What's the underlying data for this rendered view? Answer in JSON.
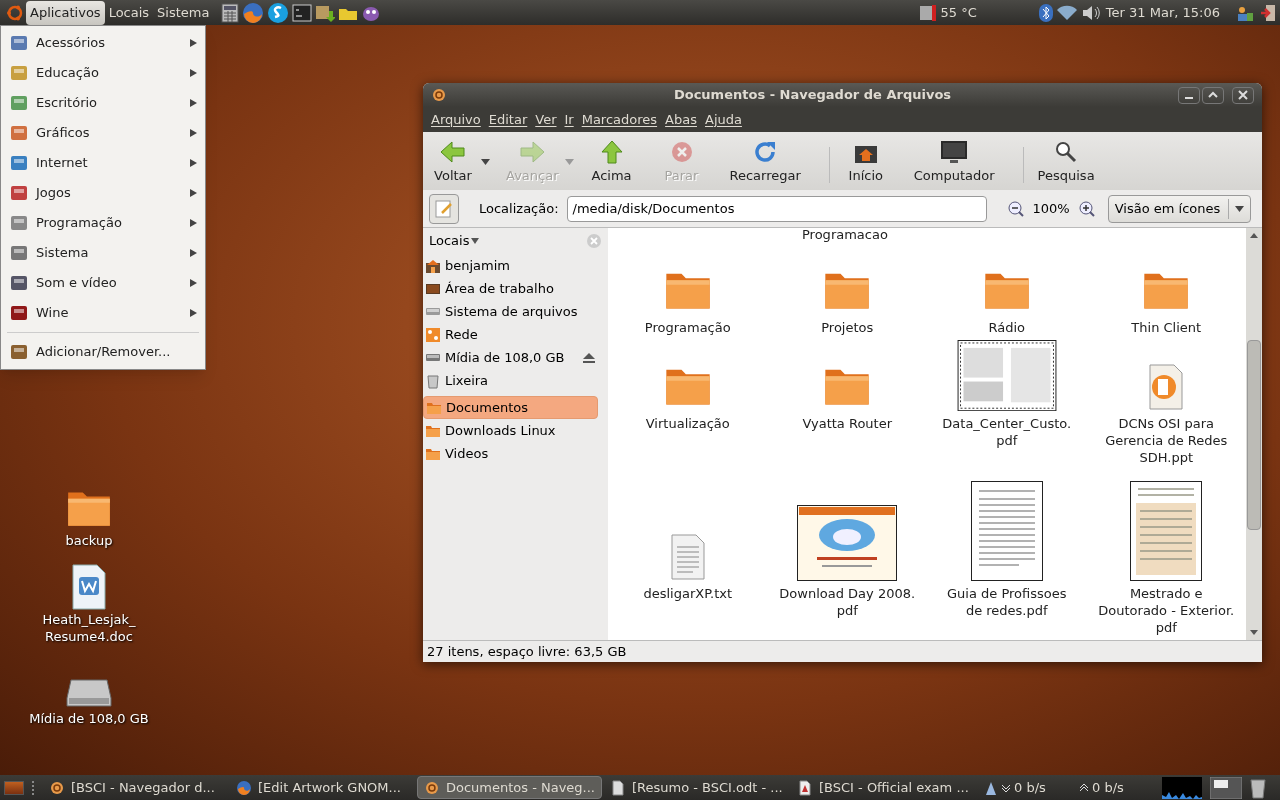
{
  "top_panel": {
    "menus": [
      {
        "label": "Aplicativos",
        "selected": true
      },
      {
        "label": "Locais",
        "selected": false
      },
      {
        "label": "Sistema",
        "selected": false
      }
    ],
    "temperature": "55 °C",
    "clock": "Ter 31 Mar, 15:06"
  },
  "app_menu": {
    "items": [
      {
        "label": "Acessórios",
        "kind": "submenu"
      },
      {
        "label": "Educação",
        "kind": "submenu"
      },
      {
        "label": "Escritório",
        "kind": "submenu"
      },
      {
        "label": "Gráficos",
        "kind": "submenu"
      },
      {
        "label": "Internet",
        "kind": "submenu"
      },
      {
        "label": "Jogos",
        "kind": "submenu"
      },
      {
        "label": "Programação",
        "kind": "submenu"
      },
      {
        "label": "Sistema",
        "kind": "submenu"
      },
      {
        "label": "Som e vídeo",
        "kind": "submenu"
      },
      {
        "label": "Wine",
        "kind": "submenu"
      },
      {
        "label": "Adicionar/Remover...",
        "kind": "action"
      }
    ]
  },
  "desktop_icons": [
    {
      "label": "backup",
      "kind": "folder"
    },
    {
      "label": "Heath_Lesjak_\nResume4.doc",
      "kind": "document"
    },
    {
      "label": "Mídia de 108,0 GB",
      "kind": "drive"
    }
  ],
  "window": {
    "title": "Documentos - Navegador de Arquivos",
    "menu": [
      "Arquivo",
      "Editar",
      "Ver",
      "Ir",
      "Marcadores",
      "Abas",
      "Ajuda"
    ],
    "toolbar": [
      {
        "label": "Voltar",
        "kind": "back",
        "disabled": false,
        "dropdown": true
      },
      {
        "label": "Avançar",
        "kind": "forward",
        "disabled": true,
        "dropdown": true
      },
      {
        "label": "Acima",
        "kind": "up",
        "disabled": false,
        "dropdown": false
      },
      {
        "label": "Parar",
        "kind": "stop",
        "disabled": true,
        "dropdown": false
      },
      {
        "label": "Recarregar",
        "kind": "reload",
        "disabled": false,
        "dropdown": false
      },
      {
        "label": "Início",
        "kind": "home",
        "disabled": false,
        "dropdown": false
      },
      {
        "label": "Computador",
        "kind": "computer",
        "disabled": false,
        "dropdown": false
      },
      {
        "label": "Pesquisa",
        "kind": "search",
        "disabled": false,
        "dropdown": false
      }
    ],
    "location_label": "Localização:",
    "location": "/media/disk/Documentos",
    "zoom": "100%",
    "view": "Visão em ícones",
    "sidebar": {
      "title": "Locais",
      "items": [
        {
          "label": "benjamim",
          "kind": "home",
          "selected": false
        },
        {
          "label": "Área de trabalho",
          "kind": "desktop",
          "selected": false
        },
        {
          "label": "Sistema de arquivos",
          "kind": "drive",
          "selected": false
        },
        {
          "label": "Rede",
          "kind": "network",
          "selected": false
        },
        {
          "label": "Mídia de 108,0 GB",
          "kind": "media",
          "selected": false
        },
        {
          "label": "Lixeira",
          "kind": "trash",
          "selected": false
        },
        {
          "label": "Documentos",
          "kind": "folder",
          "selected": true
        },
        {
          "label": "Downloads Linux",
          "kind": "folder",
          "selected": false
        },
        {
          "label": "Videos",
          "kind": "folder",
          "selected": false
        }
      ]
    },
    "partial_label": "Programacao",
    "files": [
      {
        "label": "Programação",
        "kind": "folder"
      },
      {
        "label": "Projetos",
        "kind": "folder"
      },
      {
        "label": "Rádio",
        "kind": "folder"
      },
      {
        "label": "Thin Client",
        "kind": "folder"
      },
      {
        "label": "Virtualização",
        "kind": "folder"
      },
      {
        "label": "Vyatta Router",
        "kind": "folder"
      },
      {
        "label": "Data_Center_Custo.\npdf",
        "kind": "pdf-wide"
      },
      {
        "label": "DCNs OSI para\nGerencia de Redes\nSDH.ppt",
        "kind": "ppt"
      },
      {
        "label": "desligarXP.txt",
        "kind": "txt"
      },
      {
        "label": "Download Day 2008.\npdf",
        "kind": "pdf-colorful"
      },
      {
        "label": "Guia de Profissoes\nde redes.pdf",
        "kind": "pdf"
      },
      {
        "label": "Mestrado e\nDoutorado - Exterior.\npdf",
        "kind": "pdf-tan"
      }
    ],
    "status": "27 itens, espaço livre: 63,5 GB"
  },
  "bottom_panel": {
    "tasks": [
      {
        "label": "[BSCI - Navegador d...",
        "kind": "files",
        "selected": false
      },
      {
        "label": "[Edit Artwork GNOM...",
        "kind": "browser",
        "selected": false
      },
      {
        "label": "Documentos - Naveg...",
        "kind": "files",
        "selected": true
      },
      {
        "label": "[Resumo - BSCI.odt - ...",
        "kind": "document",
        "selected": false
      },
      {
        "label": "[BSCI - Official exam ...",
        "kind": "pdf",
        "selected": false
      }
    ],
    "download": "0 b/s",
    "upload": "0 b/s"
  }
}
